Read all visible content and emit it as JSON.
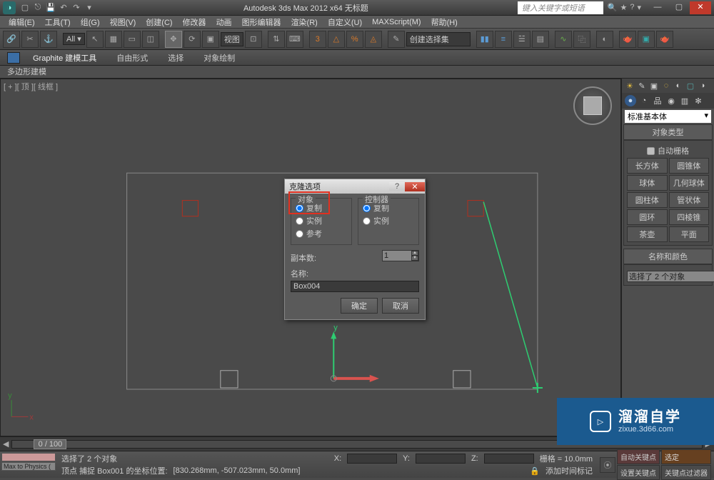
{
  "titlebar": {
    "title": "Autodesk 3ds Max  2012 x64     无标题",
    "search_placeholder": "键入关键字或短语"
  },
  "menubar": [
    "编辑(E)",
    "工具(T)",
    "组(G)",
    "视图(V)",
    "创建(C)",
    "修改器",
    "动画",
    "图形编辑器",
    "渲染(R)",
    "自定义(U)",
    "MAXScript(M)",
    "帮助(H)"
  ],
  "toolbar": {
    "viewport_dd": "视图",
    "selection_dd": "创建选择集"
  },
  "ribbon": {
    "tabs": [
      "Graphite 建模工具",
      "自由形式",
      "选择",
      "对象绘制"
    ],
    "sub": "多边形建模"
  },
  "viewport": {
    "label": "[ + ][ 顶 ][ 线框 ]"
  },
  "cmd_panel": {
    "category": "标准基本体",
    "rollout1_title": "对象类型",
    "autogrid": "自动栅格",
    "primitives": [
      "长方体",
      "圆锥体",
      "球体",
      "几何球体",
      "圆柱体",
      "管状体",
      "圆环",
      "四棱锥",
      "茶壶",
      "平面"
    ],
    "rollout2_title": "名称和颜色",
    "selection_text": "选择了 2 个对象"
  },
  "dialog": {
    "title": "克隆选项",
    "group_object": "对象",
    "group_controller": "控制器",
    "opt_copy": "复制",
    "opt_instance": "实例",
    "opt_reference": "参考",
    "copies_label": "副本数:",
    "copies_value": "1",
    "name_label": "名称:",
    "name_value": "Box004",
    "ok": "确定",
    "cancel": "取消"
  },
  "timeline": {
    "frame_display": "0 / 100"
  },
  "status": {
    "script_btn": "Max to Physics (",
    "line1": "选择了 2 个对象",
    "line2_prefix": "顶点  捕捉 Box001 的坐标位置:",
    "line2_coords": "[830.268mm, -507.023mm, 50.0mm]",
    "x_label": "X:",
    "y_label": "Y:",
    "z_label": "Z:",
    "grid": "栅格 = 10.0mm",
    "add_marker": "添加时间标记",
    "autokey": "自动关键点",
    "selpill": "选定",
    "setkey": "设置关键点",
    "keyfilter": "关键点过滤器"
  },
  "watermark": {
    "brand": "溜溜自学",
    "url": "zixue.3d66.com"
  }
}
